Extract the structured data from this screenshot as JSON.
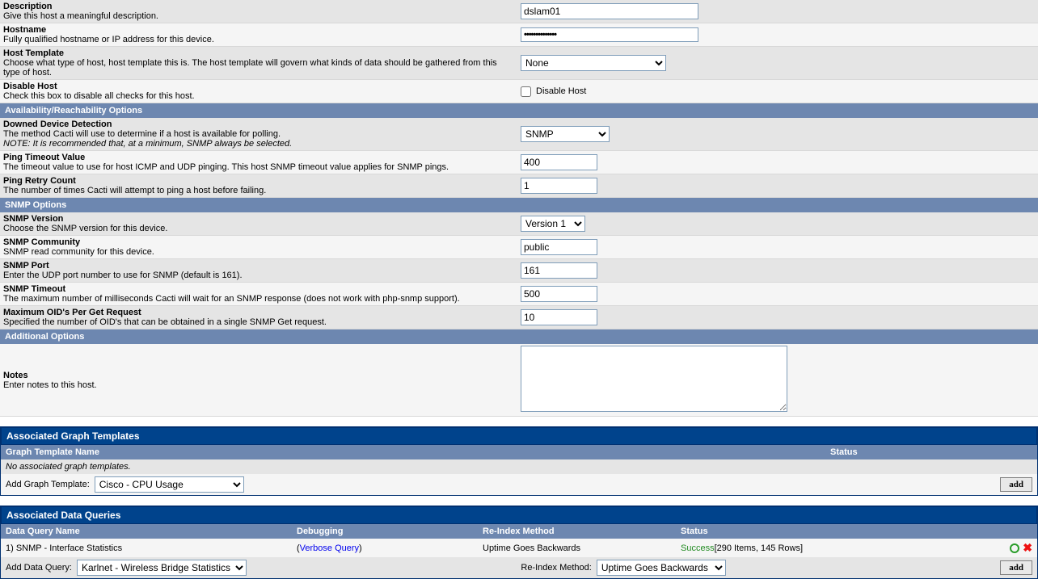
{
  "general": {
    "description": {
      "title": "Description",
      "desc": "Give this host a meaningful description.",
      "value": "dslam01"
    },
    "hostname": {
      "title": "Hostname",
      "desc": "Fully qualified hostname or IP address for this device.",
      "value": "••••••••••••••"
    },
    "host_template": {
      "title": "Host Template",
      "desc": "Choose what type of host, host template this is. The host template will govern what kinds of data should be gathered from this type of host.",
      "value": "None"
    },
    "disable_host": {
      "title": "Disable Host",
      "desc": "Check this box to disable all checks for this host.",
      "label": "Disable Host"
    }
  },
  "sections": {
    "avail": "Availability/Reachability Options",
    "snmp": "SNMP Options",
    "additional": "Additional Options"
  },
  "avail": {
    "detection": {
      "title": "Downed Device Detection",
      "desc": "The method Cacti will use to determine if a host is available for polling.",
      "note": "NOTE: It is recommended that, at a minimum, SNMP always be selected.",
      "value": "SNMP"
    },
    "ping_timeout": {
      "title": "Ping Timeout Value",
      "desc": "The timeout value to use for host ICMP and UDP pinging. This host SNMP timeout value applies for SNMP pings.",
      "value": "400"
    },
    "ping_retry": {
      "title": "Ping Retry Count",
      "desc": "The number of times Cacti will attempt to ping a host before failing.",
      "value": "1"
    }
  },
  "snmp": {
    "version": {
      "title": "SNMP Version",
      "desc": "Choose the SNMP version for this device.",
      "value": "Version 1"
    },
    "community": {
      "title": "SNMP Community",
      "desc": "SNMP read community for this device.",
      "value": "public"
    },
    "port": {
      "title": "SNMP Port",
      "desc": "Enter the UDP port number to use for SNMP (default is 161).",
      "value": "161"
    },
    "timeout": {
      "title": "SNMP Timeout",
      "desc": "The maximum number of milliseconds Cacti will wait for an SNMP response (does not work with php-snmp support).",
      "value": "500"
    },
    "max_oids": {
      "title": "Maximum OID's Per Get Request",
      "desc": "Specified the number of OID's that can be obtained in a single SNMP Get request.",
      "value": "10"
    }
  },
  "notes": {
    "title": "Notes",
    "desc": "Enter notes to this host.",
    "value": ""
  },
  "agt": {
    "header": "Associated Graph Templates",
    "col_name": "Graph Template Name",
    "col_status": "Status",
    "empty": "No associated graph templates.",
    "add_label": "Add Graph Template:",
    "select_value": "Cisco - CPU Usage",
    "add_btn": "add"
  },
  "adq": {
    "header": "Associated Data Queries",
    "col_name": "Data Query Name",
    "col_debug": "Debugging",
    "col_reindex": "Re-Index Method",
    "col_status": "Status",
    "row": {
      "num": "1)",
      "name": "SNMP - Interface Statistics",
      "debug_link": "Verbose Query",
      "reindex": "Uptime Goes Backwards",
      "status_word": "Success",
      "status_detail": " [290 Items, 145 Rows]"
    },
    "add_label": "Add Data Query:",
    "select_value": "Karlnet - Wireless Bridge Statistics",
    "reindex_label": "Re-Index Method:",
    "reindex_value": "Uptime Goes Backwards",
    "add_btn": "add"
  }
}
